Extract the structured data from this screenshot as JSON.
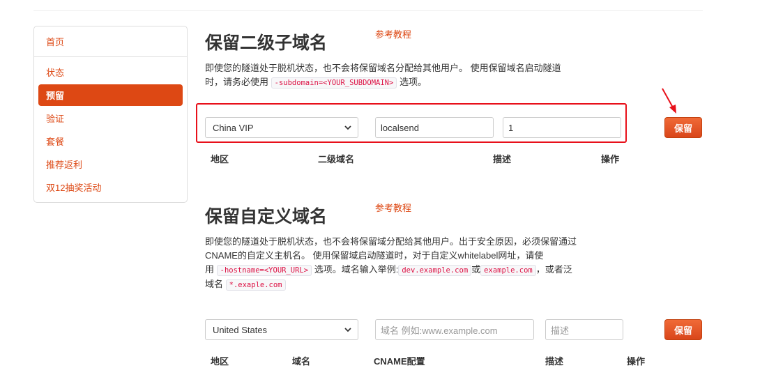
{
  "sidebar": {
    "home": "首页",
    "items": [
      {
        "label": "状态",
        "active": false
      },
      {
        "label": "预留",
        "active": true
      },
      {
        "label": "验证",
        "active": false
      },
      {
        "label": "套餐",
        "active": false
      },
      {
        "label": "推荐返利",
        "active": false
      },
      {
        "label": "双12抽奖活动",
        "active": false
      }
    ]
  },
  "subdomain": {
    "title": "保留二级子域名",
    "ref_link": "参考教程",
    "desc_a": "即使您的隧道处于脱机状态，也不会将保留域名分配给其他用户。 使用保留域名启动隧道",
    "desc_b": "时，请务必使用",
    "desc_code": "-subdomain=<YOUR_SUBDOMAIN>",
    "desc_c": "选项。",
    "region_value": "China VIP",
    "subdomain_value": "localsend",
    "description_value": "1",
    "save_label": "保留",
    "columns": [
      "地区",
      "二级域名",
      "描述",
      "操作"
    ]
  },
  "custom": {
    "title": "保留自定义域名",
    "ref_link": "参考教程",
    "line1": "即使您的隧道处于脱机状态，也不会将保留域分配给其他用户。出于安全原因，必须保留通过",
    "line2": "CNAME的自定义主机名。 使用保留域启动隧道时，对于自定义whitelabel网址，请使",
    "line3_a": "用",
    "code_hostname": "-hostname=<YOUR_URL>",
    "line3_b": "选项。域名输入举例:",
    "code_example1": "dev.example.com",
    "line3_c": "或",
    "code_example2": "example.com",
    "line3_d": "，或者泛",
    "line4_a": "域名",
    "code_wildcard": "*.exaple.com",
    "region_value": "United States",
    "domain_placeholder": "域名 例如:www.example.com",
    "description_placeholder": "描述",
    "save_label": "保留",
    "columns": [
      "地区",
      "域名",
      "CNAME配置",
      "描述",
      "操作"
    ]
  },
  "colors": {
    "accent": "#dd4814",
    "highlight_box": "#e8101a",
    "arrow": "#e8101a"
  }
}
